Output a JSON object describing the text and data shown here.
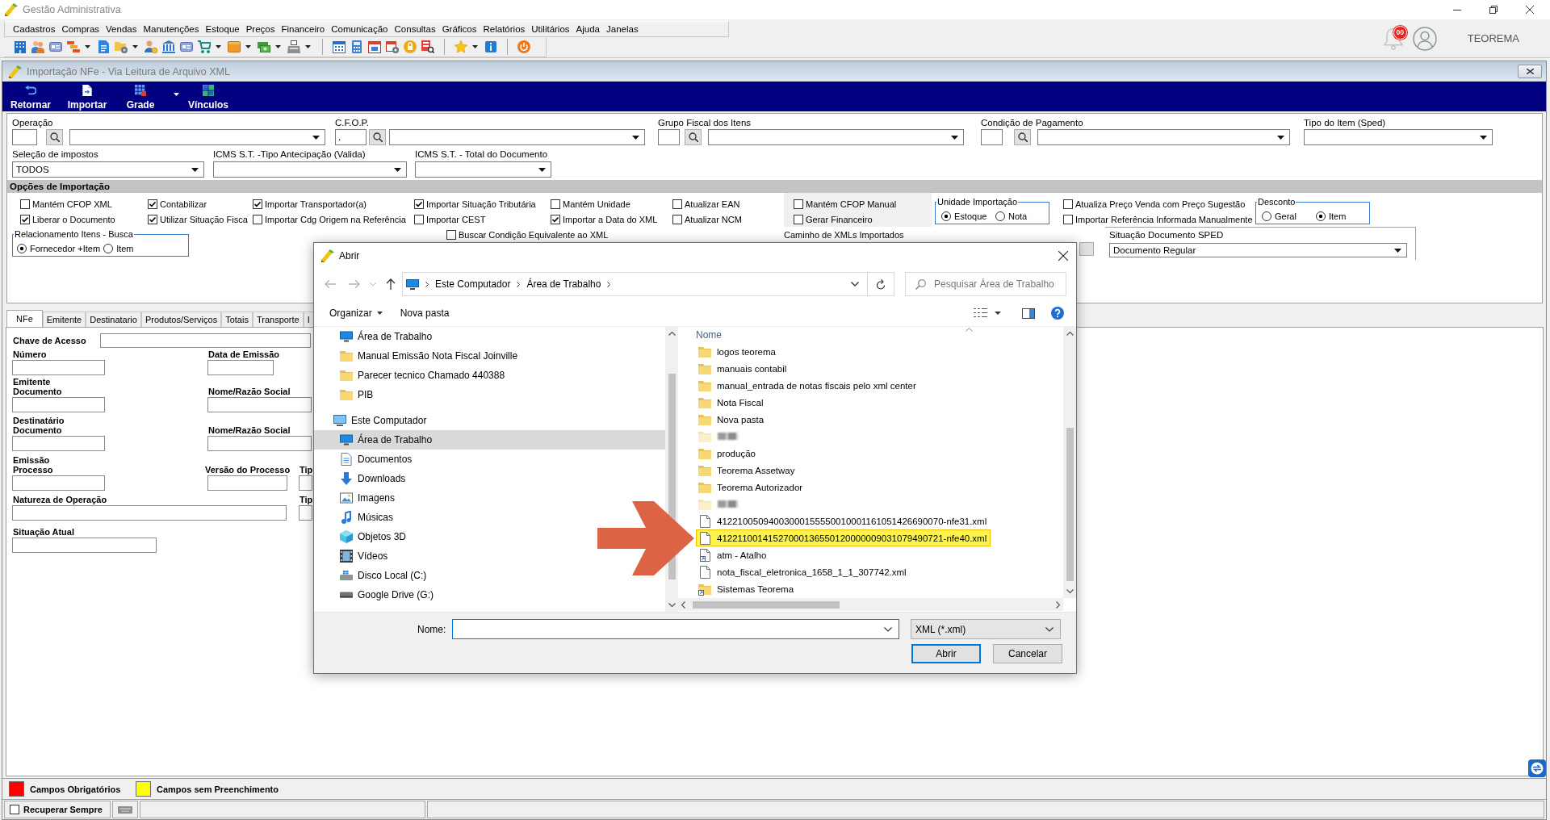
{
  "window": {
    "title": "Gestão Administrativa"
  },
  "menu": [
    "Cadastros",
    "Compras",
    "Vendas",
    "Manutenções",
    "Estoque",
    "Preços",
    "Financeiro",
    "Comunicação",
    "Consultas",
    "Gráficos",
    "Relatórios",
    "Utilitários",
    "Ajuda",
    "Janelas"
  ],
  "header": {
    "notifications": "00",
    "user": "TEOREMA"
  },
  "document_window": {
    "title": "Importação NFe - Via Leitura de Arquivo XML"
  },
  "actions": [
    {
      "label": "Retornar",
      "kind": "button"
    },
    {
      "label": "Importar",
      "kind": "button"
    },
    {
      "label": "Grade",
      "kind": "dropdown"
    },
    {
      "label": "Vínculos",
      "kind": "button"
    }
  ],
  "filters_row1": [
    {
      "label": "Operação",
      "kind": "lookup"
    },
    {
      "label": "C.F.O.P.",
      "kind": "lookup",
      "code": "."
    },
    {
      "label": "Grupo Fiscal dos Itens",
      "kind": "lookup"
    },
    {
      "label": "Condição de Pagamento",
      "kind": "lookup"
    },
    {
      "label": "Tipo do Item (Sped)",
      "kind": "combo"
    }
  ],
  "filters_row2": [
    {
      "label": "Seleção de impostos",
      "kind": "combo",
      "value": "TODOS"
    },
    {
      "label": "ICMS S.T. -Tipo Antecipação (Valida)",
      "kind": "combo"
    },
    {
      "label": "ICMS S.T. - Total do Documento",
      "kind": "combo"
    }
  ],
  "import_options": {
    "title": "Opções de Importação",
    "blocks": [
      {
        "kind": "checks",
        "items": [
          {
            "label": "Mantém CFOP XML",
            "checked": false
          },
          {
            "label": "Liberar o Documento",
            "checked": true
          }
        ]
      },
      {
        "kind": "checks",
        "items": [
          {
            "label": "Contabilizar",
            "checked": true
          },
          {
            "label": "Utilizar Situação Fisca",
            "checked": true
          }
        ]
      },
      {
        "kind": "checks",
        "items": [
          {
            "label": "Importar Transportador(a)",
            "checked": true
          },
          {
            "label": "Importar Cdg Origem na Referência",
            "checked": false
          }
        ]
      },
      {
        "kind": "checks",
        "items": [
          {
            "label": "Importar Situação Tributária",
            "checked": true
          },
          {
            "label": "Importar CEST",
            "checked": false
          }
        ]
      },
      {
        "kind": "checks",
        "items": [
          {
            "label": "Mantém Unidade",
            "checked": false
          },
          {
            "label": "Importar a Data do XML",
            "checked": true
          }
        ]
      },
      {
        "kind": "checks",
        "items": [
          {
            "label": "Atualizar EAN",
            "checked": false
          },
          {
            "label": "Atualizar NCM",
            "checked": false
          }
        ]
      },
      {
        "kind": "shaded_checks",
        "items": [
          {
            "label": "Mantém CFOP Manual",
            "checked": false
          },
          {
            "label": "Gerar Financeiro",
            "checked": false
          }
        ]
      },
      {
        "kind": "radio_group",
        "title": "Unidade Importação",
        "options": [
          {
            "label": "Estoque",
            "selected": true
          },
          {
            "label": "Nota",
            "selected": false
          }
        ]
      },
      {
        "kind": "checks",
        "items": [
          {
            "label": "Atualiza Preço Venda com Preço Sugestão",
            "checked": false
          },
          {
            "label": "Importar Referência Informada Manualmente",
            "checked": false
          }
        ]
      },
      {
        "kind": "radio_group",
        "title": "Desconto",
        "options": [
          {
            "label": "Geral",
            "selected": false
          },
          {
            "label": "Item",
            "selected": true
          }
        ]
      }
    ]
  },
  "extra": {
    "item_match": {
      "title": "Relacionamento Itens - Busca",
      "options": [
        {
          "label": "Fornecedor +Item",
          "selected": true
        },
        {
          "label": "Item",
          "selected": false
        }
      ]
    },
    "equivalent_condition": {
      "label": "Buscar Condição Equivalente ao XML",
      "checked": false
    },
    "xml_path": {
      "label": "Caminho de XMLs Importados"
    },
    "sped_status": {
      "label": "Situação Documento SPED",
      "value": "Documento Regular"
    }
  },
  "tabs": [
    {
      "label": "NFe",
      "selected": true
    },
    {
      "label": "Emitente",
      "selected": false
    },
    {
      "label": "Destinatario",
      "selected": false
    },
    {
      "label": "Produtos/Serviços",
      "selected": false
    },
    {
      "label": "Totais",
      "selected": false
    },
    {
      "label": "Transporte",
      "selected": false
    },
    {
      "label": "I",
      "selected": false
    }
  ],
  "nfe_form": [
    {
      "kind": "inline",
      "fields": [
        {
          "label": "Chave de Acesso"
        }
      ]
    },
    {
      "kind": "row",
      "fields": [
        {
          "label": "Número"
        },
        {
          "label": "Data de Emissão"
        }
      ]
    },
    {
      "kind": "row",
      "heading": "Emitente",
      "fields": [
        {
          "label": "Documento"
        },
        {
          "label": "Nome/Razão Social"
        }
      ]
    },
    {
      "kind": "row",
      "heading": "Destinatário",
      "fields": [
        {
          "label": "Documento"
        },
        {
          "label": "Nome/Razão Social"
        }
      ]
    },
    {
      "kind": "row",
      "heading": "Emissão",
      "fields": [
        {
          "label": "Processo"
        },
        {
          "label": "Versão do Processo"
        },
        {
          "label": "Tip"
        }
      ]
    },
    {
      "kind": "row",
      "fields": [
        {
          "label": "Natureza de Operação"
        },
        {
          "label": "Tip"
        }
      ]
    },
    {
      "kind": "row",
      "fields": [
        {
          "label": "Situação Atual"
        }
      ]
    }
  ],
  "legend": [
    {
      "label": "Campos Obrigatórios",
      "color": "#ff0000"
    },
    {
      "label": "Campos sem Preenchimento",
      "color": "#ffff00"
    }
  ],
  "status_bar": {
    "recover_always": {
      "label": "Recuperar Sempre",
      "checked": false
    }
  },
  "open_dialog": {
    "title": "Abrir",
    "path": [
      "Este Computador",
      "Área de Trabalho"
    ],
    "search_placeholder": "Pesquisar Área de Trabalho",
    "commands": [
      {
        "label": "Organizar",
        "kind": "menu"
      },
      {
        "label": "Nova pasta",
        "kind": "button"
      }
    ],
    "nav": {
      "quick_access": [
        {
          "label": "Área de Trabalho",
          "kind": "desktop",
          "selected": false
        },
        {
          "label": "Manual Emissão Nota Fiscal Joinville",
          "kind": "folder",
          "selected": false
        },
        {
          "label": "Parecer tecnico Chamado 440388",
          "kind": "folder",
          "selected": false
        },
        {
          "label": "PIB",
          "kind": "folder",
          "selected": false
        }
      ],
      "this_pc": {
        "label": "Este Computador",
        "kind": "computer",
        "selected": false,
        "children": [
          {
            "label": "Área de Trabalho",
            "kind": "desktop",
            "selected": true
          },
          {
            "label": "Documentos",
            "kind": "documents",
            "selected": false
          },
          {
            "label": "Downloads",
            "kind": "downloads",
            "selected": false
          },
          {
            "label": "Imagens",
            "kind": "images",
            "selected": false
          },
          {
            "label": "Músicas",
            "kind": "music",
            "selected": false
          },
          {
            "label": "Objetos 3D",
            "kind": "objects3d",
            "selected": false
          },
          {
            "label": "Vídeos",
            "kind": "videos",
            "selected": false
          },
          {
            "label": "Disco Local (C:)",
            "kind": "system_drive",
            "selected": false
          },
          {
            "label": "Google Drive (G:)",
            "kind": "drive",
            "selected": false
          }
        ]
      }
    },
    "column": "Nome",
    "files": [
      {
        "name": "logos teorema",
        "kind": "folder",
        "highlighted": false
      },
      {
        "name": "manuais contabil",
        "kind": "folder",
        "highlighted": false
      },
      {
        "name": "manual_entrada de notas fiscais pelo xml center",
        "kind": "folder",
        "highlighted": false
      },
      {
        "name": "Nota Fiscal",
        "kind": "folder",
        "highlighted": false
      },
      {
        "name": "Nova pasta",
        "kind": "folder",
        "highlighted": false
      },
      {
        "kind": "blurred",
        "highlighted": false
      },
      {
        "name": "produção",
        "kind": "folder",
        "highlighted": false
      },
      {
        "name": "Teorema Assetway",
        "kind": "folder",
        "highlighted": false
      },
      {
        "name": "Teorema Autorizador",
        "kind": "folder",
        "highlighted": false
      },
      {
        "kind": "blurred",
        "highlighted": false
      },
      {
        "name": "41221005094003000155550010001161051426690070-nfe31.xml",
        "kind": "file",
        "highlighted": false
      },
      {
        "name": "41221100141527000136550120000009031079490721-nfe40.xml",
        "kind": "file",
        "highlighted": true
      },
      {
        "name": "atm - Atalho",
        "kind": "shortcut",
        "highlighted": false
      },
      {
        "name": "nota_fiscal_eletronica_1658_1_1_307742.xml",
        "kind": "file",
        "highlighted": false
      },
      {
        "name": "Sistemas Teorema",
        "kind": "folder_shortcut",
        "highlighted": false
      }
    ],
    "file_name": {
      "label": "Nome:"
    },
    "file_type": "XML (*.xml)",
    "buttons": [
      {
        "label": "Abrir",
        "default": true
      },
      {
        "label": "Cancelar",
        "default": false
      }
    ]
  }
}
